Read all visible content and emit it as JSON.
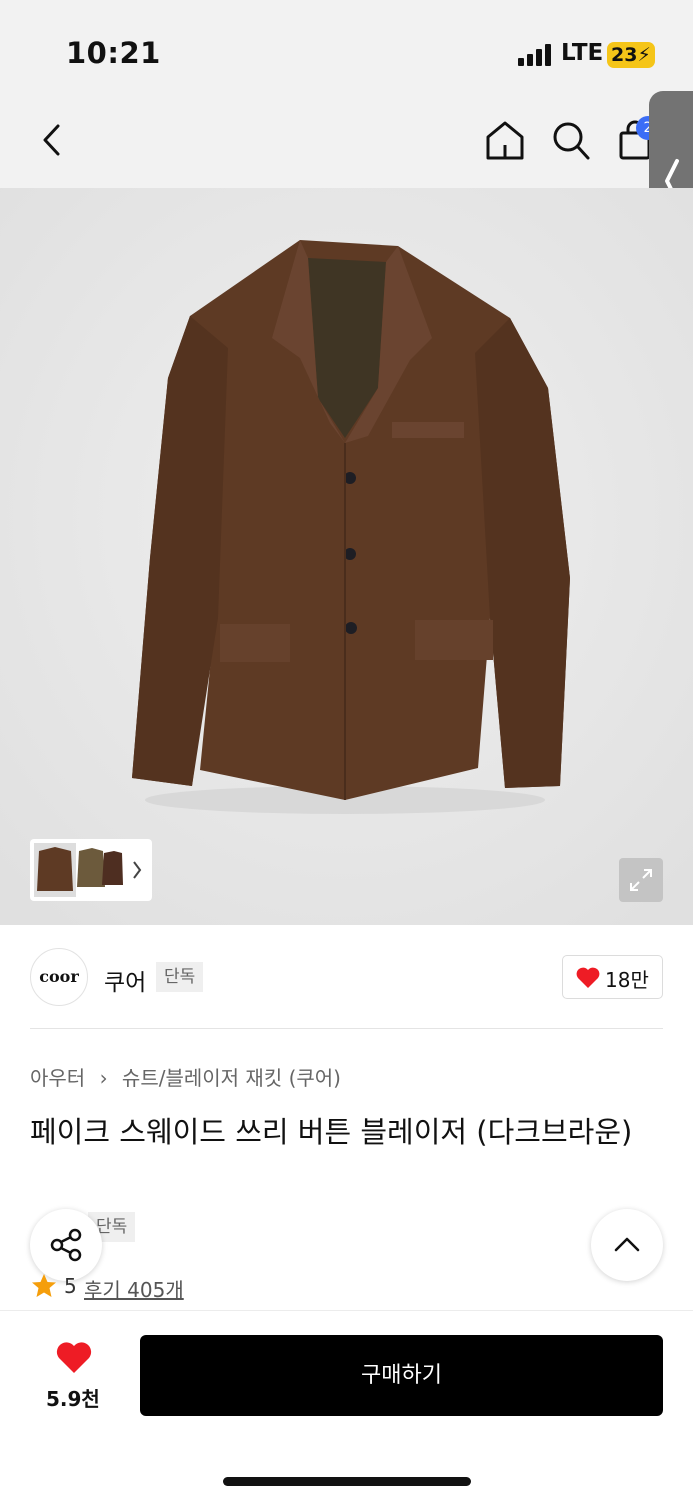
{
  "status_bar": {
    "time": "10:21",
    "network": "LTE",
    "battery": "23"
  },
  "nav": {
    "cart_count": "2"
  },
  "brand": {
    "logo_text": "coor",
    "name": "쿠어",
    "badge": "단독",
    "likes": "18만"
  },
  "breadcrumb": {
    "category": "아우터",
    "subcategory": "슈트/블레이저 재킷 (쿠어)"
  },
  "product": {
    "title": "페이크 스웨이드 쓰리 버튼 블레이저 (다크브라운)",
    "badge": "단독",
    "rating": "5",
    "reviews": "후기 405개"
  },
  "bottom_bar": {
    "likes": "5.9천",
    "buy_label": "구매하기"
  },
  "colors": {
    "accent": "#3b6df6",
    "heart": "#ee1c25",
    "star": "#f59e0b",
    "jacket": "#5e3a24"
  }
}
